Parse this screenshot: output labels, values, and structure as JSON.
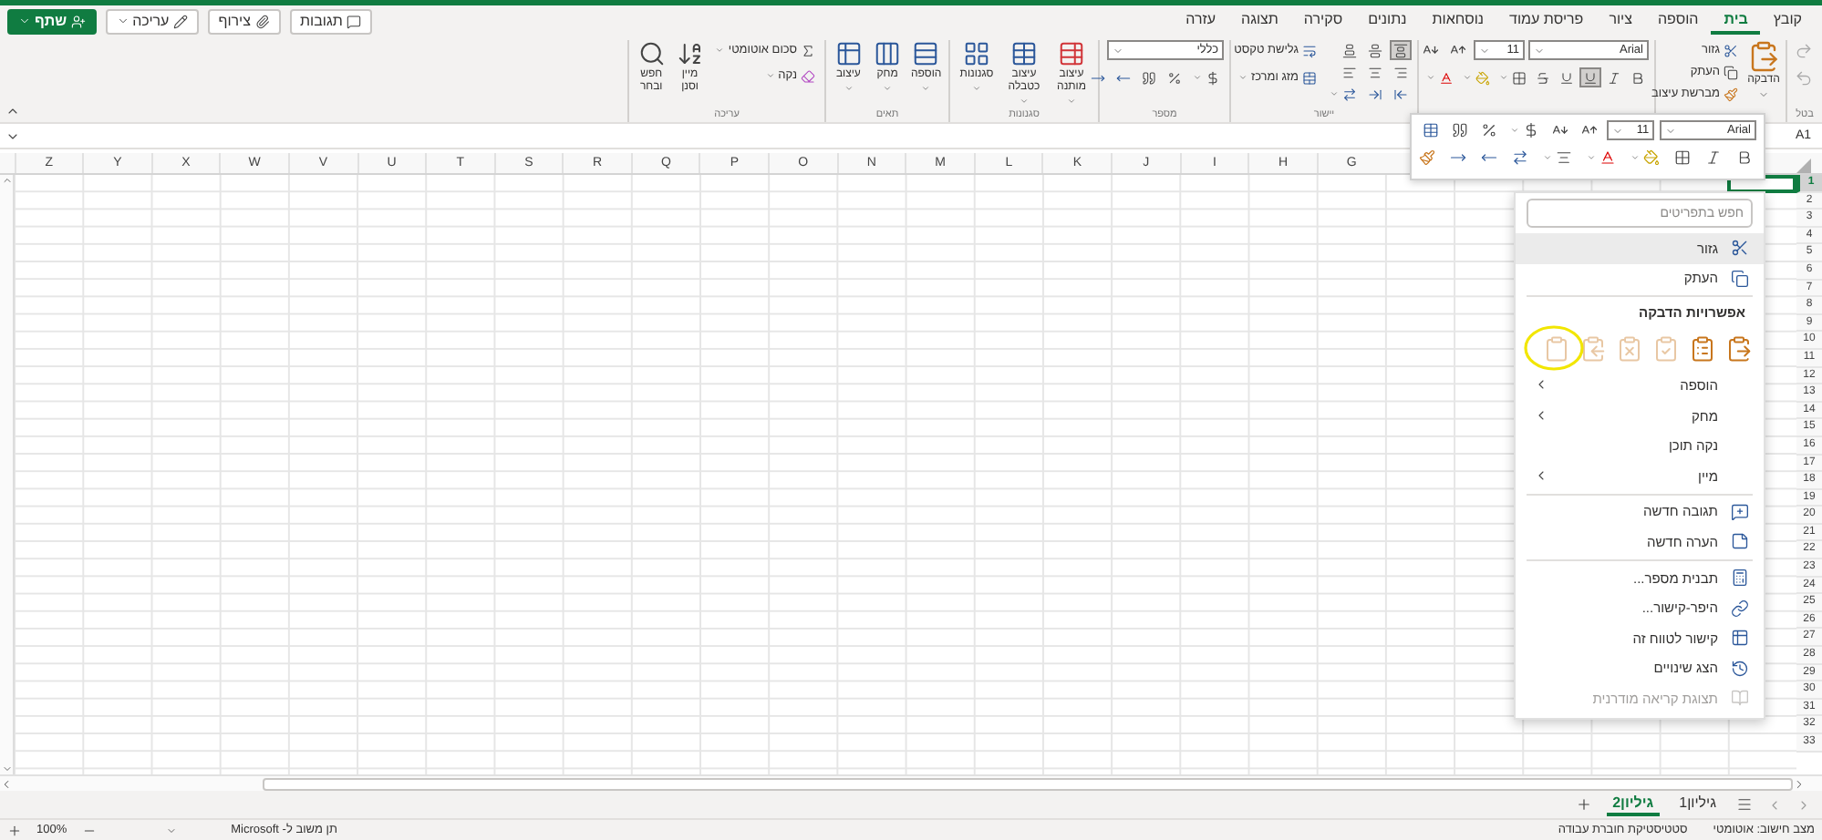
{
  "tabs": [
    {
      "label": "קובץ",
      "selected": false
    },
    {
      "label": "בית",
      "selected": true
    },
    {
      "label": "הוספה",
      "selected": false
    },
    {
      "label": "ציור",
      "selected": false
    },
    {
      "label": "פריסת עמוד",
      "selected": false
    },
    {
      "label": "נוסחאות",
      "selected": false
    },
    {
      "label": "נתונים",
      "selected": false
    },
    {
      "label": "סקירה",
      "selected": false
    },
    {
      "label": "תצוגה",
      "selected": false
    },
    {
      "label": "עזרה",
      "selected": false
    }
  ],
  "actions": [
    {
      "kind": "comments",
      "label": "תגובות"
    },
    {
      "kind": "attach",
      "label": "צירוף"
    },
    {
      "kind": "edit",
      "label": "עריכה"
    },
    {
      "kind": "share",
      "label": "שתף"
    }
  ],
  "ribbon": {
    "undo_label": "בטל",
    "clipboard": {
      "paste": "הדבקה",
      "cut": "גזור",
      "copy": "העתק",
      "format_painter": "מברשת עיצוב"
    },
    "font": {
      "name": "Arial",
      "size": "11",
      "underline": {
        "selected": true
      }
    },
    "alignment": {
      "label": "יישור",
      "wrap_text": "גלישת טקסט",
      "merge": "מזג ומרכז",
      "top_align": {
        "selected": true
      }
    },
    "number": {
      "label": "מספר",
      "format": "כללי"
    },
    "styles": {
      "label": "סגנונות",
      "buttons": [
        "עיצוב מותנה",
        "עיצוב כטבלה",
        "סגנונות"
      ]
    },
    "cells": {
      "label": "תאים",
      "buttons": [
        "הוספה",
        "מחק",
        "עיצוב"
      ]
    },
    "editing": {
      "label": "עריכה",
      "autosum": "סכום אוטומטי",
      "clear": "נקה",
      "sort_filter": "מיין וסנן",
      "find_select": "חפש ובחר"
    }
  },
  "name_box": "A1",
  "columns": [
    "G",
    "H",
    "I",
    "J",
    "K",
    "L",
    "M",
    "N",
    "O",
    "P",
    "Q",
    "R",
    "S",
    "T",
    "U",
    "V",
    "W",
    "X",
    "Y",
    "Z"
  ],
  "rows": [
    {
      "label": "1",
      "selected": true
    },
    {
      "label": "2",
      "selected": false
    },
    {
      "label": "3",
      "selected": false
    },
    {
      "label": "4",
      "selected": false
    },
    {
      "label": "5",
      "selected": false
    },
    {
      "label": "6",
      "selected": false
    },
    {
      "label": "7",
      "selected": false
    },
    {
      "label": "8",
      "selected": false
    },
    {
      "label": "9",
      "selected": false
    },
    {
      "label": "10",
      "selected": false
    },
    {
      "label": "11",
      "selected": false
    },
    {
      "label": "12",
      "selected": false
    },
    {
      "label": "13",
      "selected": false
    },
    {
      "label": "14",
      "selected": false
    },
    {
      "label": "15",
      "selected": false
    },
    {
      "label": "16",
      "selected": false
    },
    {
      "label": "17",
      "selected": false
    },
    {
      "label": "18",
      "selected": false
    },
    {
      "label": "19",
      "selected": false
    },
    {
      "label": "20",
      "selected": false
    },
    {
      "label": "21",
      "selected": false
    },
    {
      "label": "22",
      "selected": false
    },
    {
      "label": "23",
      "selected": false
    },
    {
      "label": "24",
      "selected": false
    },
    {
      "label": "25",
      "selected": false
    },
    {
      "label": "26",
      "selected": false
    },
    {
      "label": "27",
      "selected": false
    },
    {
      "label": "28",
      "selected": false
    },
    {
      "label": "29",
      "selected": false
    },
    {
      "label": "30",
      "selected": false
    },
    {
      "label": "31",
      "selected": false
    },
    {
      "label": "32",
      "selected": false
    },
    {
      "label": "33",
      "selected": false
    }
  ],
  "mini_toolbar": {
    "font": "Arial",
    "size": "11"
  },
  "context_menu": {
    "search_placeholder": "חפש בתפריטים",
    "items": [
      {
        "kind": "item",
        "label": "גזור",
        "highlighted": true,
        "disabled": false
      },
      {
        "kind": "item",
        "label": "העתק",
        "highlighted": false,
        "disabled": false
      },
      {
        "kind": "separator"
      },
      {
        "kind": "header",
        "label": "אפשרויות הדבקה"
      },
      {
        "kind": "paste_options",
        "options": [
          {
            "disabled": false
          },
          {
            "disabled": false
          },
          {
            "disabled": true
          },
          {
            "disabled": true
          },
          {
            "disabled": true
          },
          {
            "disabled": true
          }
        ]
      },
      {
        "kind": "submenu",
        "label": "הוספה",
        "highlighted": false,
        "disabled": false
      },
      {
        "kind": "submenu",
        "label": "מחק",
        "highlighted": false,
        "disabled": false
      },
      {
        "kind": "item",
        "label": "נקה תוכן",
        "highlighted": false,
        "disabled": false
      },
      {
        "kind": "submenu",
        "label": "מיין",
        "highlighted": false,
        "disabled": false
      },
      {
        "kind": "separator"
      },
      {
        "kind": "item",
        "label": "תגובה חדשה",
        "highlighted": false,
        "disabled": false
      },
      {
        "kind": "item",
        "label": "הערה חדשה",
        "highlighted": false,
        "disabled": false
      },
      {
        "kind": "separator"
      },
      {
        "kind": "item",
        "label": "תבנית מספר...",
        "highlighted": false,
        "disabled": false
      },
      {
        "kind": "item",
        "label": "היפר-קישור...",
        "highlighted": false,
        "disabled": false
      },
      {
        "kind": "item",
        "label": "קישור לטווח זה",
        "highlighted": false,
        "disabled": false
      },
      {
        "kind": "item",
        "label": "הצג שינויים",
        "highlighted": false,
        "disabled": false
      },
      {
        "kind": "item",
        "label": "תצוגת קריאה מודרנית",
        "highlighted": false,
        "disabled": true
      }
    ]
  },
  "sheets": [
    {
      "label": "גיליון1",
      "selected": false
    },
    {
      "label": "גיליון2",
      "selected": true
    }
  ],
  "status": {
    "calc_mode": "מצב חישוב: אוטומטי",
    "stats": "סטטיסטיקת חוברת עבודה",
    "feedback": "תן משוב ל- Microsoft",
    "zoom": "100%"
  }
}
